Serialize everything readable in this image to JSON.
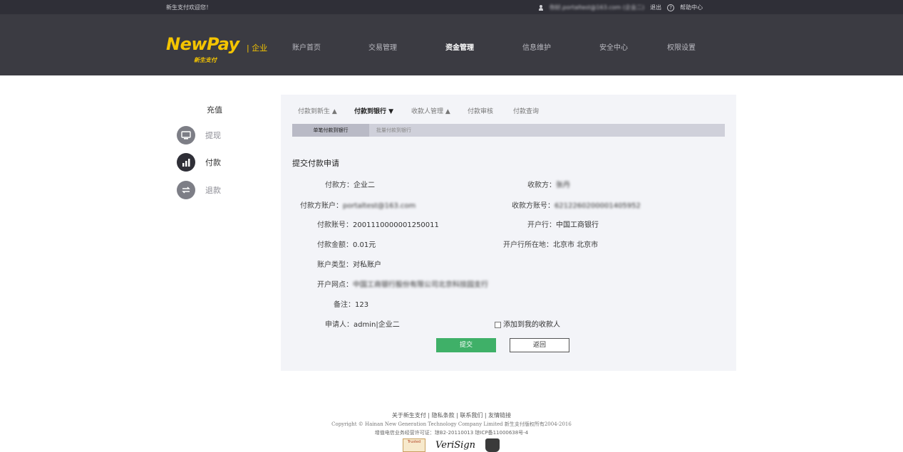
{
  "topbar": {
    "welcome": "新生支付欢迎您！",
    "greeting": "你好,portaltest@163.com (企业二)",
    "logout": "退出",
    "help": "帮助中心"
  },
  "header": {
    "logo_main": "NewPay",
    "logo_sub": "新生支付",
    "logo_enterprise": "| 企业",
    "nav": [
      "账户首页",
      "交易管理",
      "资金管理",
      "信息维护",
      "安全中心",
      "权限设置"
    ],
    "active_nav": "资金管理"
  },
  "sidebar": {
    "title": "充值",
    "items": [
      {
        "label": "提现",
        "icon": "withdraw-icon"
      },
      {
        "label": "付款",
        "icon": "payment-chart-icon"
      },
      {
        "label": "退款",
        "icon": "refund-icon"
      }
    ]
  },
  "tabs": {
    "items": [
      "付款到新生 ▲",
      "付款到银行 ▼",
      "收款人管理 ▲",
      "付款审核",
      "付款查询"
    ],
    "active": "付款到银行 ▼"
  },
  "subtabs": {
    "single": "单笔付款到银行",
    "batch": "批量付款到银行"
  },
  "form": {
    "title": "提交付款申请",
    "payer_label": "付款方：",
    "payer_value": "企业二",
    "payee_label": "收款方：",
    "payee_value": "张丹",
    "payer_account_label": "付款方账户：",
    "payer_account_value": "portaltest@163.com",
    "payee_account_label": "收款方账号：",
    "payee_account_value": "6212260200001405952",
    "pay_account_label": "付款账号：",
    "pay_account_value": "2001110000001250011",
    "bank_label": "开户行：",
    "bank_value": "中国工商银行",
    "amount_label": "付款金额：",
    "amount_value": "0.01元",
    "bank_location_label": "开户行所在地：",
    "bank_location_value": "北京市 北京市",
    "account_type_label": "账户类型：",
    "account_type_value": "对私账户",
    "branch_label": "开户网点：",
    "branch_value": "中国工商银行股份有限公司北京科技园支行",
    "remark_label": "备注：",
    "remark_value": "123",
    "applicant_label": "申请人：",
    "applicant_value": "admin|企业二",
    "add_payee_label": "添加到我的收款人",
    "submit": "提交",
    "back": "返回"
  },
  "footer": {
    "links": "关于新生支付 | 隐私条款 | 联系我们 | 友情链接",
    "copyright": "Copyright © Hainan New Generation Technology Company Limited 新生支付版权所有2004-2016",
    "license": "增值电信业务经营许可证：琼B2-20110013 琼ICP备11000638号-4",
    "badge1": "Trusted",
    "badge2": "VeriSign"
  }
}
